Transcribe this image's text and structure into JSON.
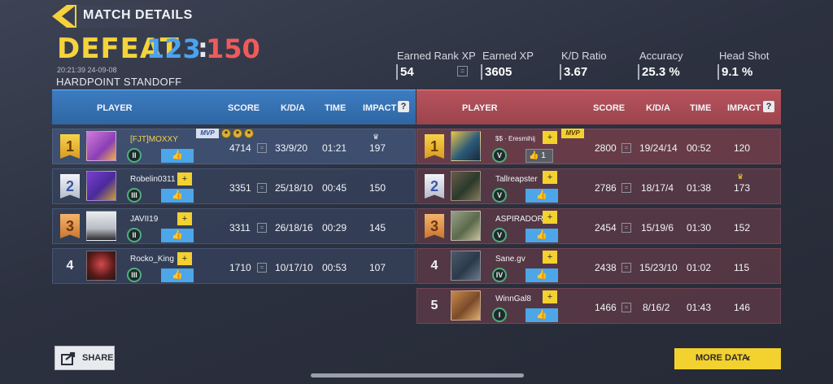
{
  "header": {
    "title": "MATCH DETAILS",
    "result": "DEFEAT",
    "score_blue": "123",
    "score_sep": ":",
    "score_red": "150",
    "time": "20:21:39 24-09-08",
    "mode": "HARDPOINT  STANDOFF"
  },
  "stats": [
    {
      "label": "Earned Rank XP",
      "value": "54"
    },
    {
      "label": "Earned XP",
      "value": "3605"
    },
    {
      "label": "K/D Ratio",
      "value": "3.67"
    },
    {
      "label": "Accuracy",
      "value": "25.3 %"
    },
    {
      "label": "Head Shot",
      "value": "9.1 %"
    }
  ],
  "columns": {
    "player": "PLAYER",
    "score": "SCORE",
    "kda": "K/D/A",
    "time": "TIME",
    "impact": "IMPACT",
    "help": "?"
  },
  "blue_team": [
    {
      "rank": "1",
      "name": "[FJT]MOXXY",
      "level": "II",
      "score": "4714",
      "kda": "33/9/20",
      "time": "01:21",
      "impact": "197",
      "mvp": "MVP"
    },
    {
      "rank": "2",
      "name": "Robelin0311",
      "level": "III",
      "score": "3351",
      "kda": "25/18/10",
      "time": "00:45",
      "impact": "150"
    },
    {
      "rank": "3",
      "name": "JAVII19",
      "level": "II",
      "score": "3311",
      "kda": "26/18/16",
      "time": "00:29",
      "impact": "145"
    },
    {
      "rank": "4",
      "name": "Rocko_King",
      "level": "III",
      "score": "1710",
      "kda": "10/17/10",
      "time": "00:53",
      "impact": "107"
    }
  ],
  "red_team": [
    {
      "rank": "1",
      "name": "$$ · Eresmihij",
      "level": "V",
      "score": "2800",
      "kda": "19/24/14",
      "time": "00:52",
      "impact": "120",
      "mvp": "MVP",
      "likes": "1"
    },
    {
      "rank": "2",
      "name": "Tallreapster",
      "level": "V",
      "score": "2786",
      "kda": "18/17/4",
      "time": "01:38",
      "impact": "173"
    },
    {
      "rank": "3",
      "name": "ASPIRADORA",
      "level": "V",
      "score": "2454",
      "kda": "15/19/6",
      "time": "01:30",
      "impact": "152"
    },
    {
      "rank": "4",
      "name": "Sane.gv",
      "level": "IV",
      "score": "2438",
      "kda": "15/23/10",
      "time": "01:02",
      "impact": "115"
    },
    {
      "rank": "5",
      "name": "WinnGal8",
      "level": "I",
      "score": "1466",
      "kda": "8/16/2",
      "time": "01:43",
      "impact": "146"
    }
  ],
  "buttons": {
    "share": "SHARE",
    "more": "MORE DATA"
  },
  "colors": {
    "accent": "#f3d12f",
    "blue_team": "#3c7cc1",
    "red_team": "#b7535c",
    "score_blue": "#4aa3f0",
    "score_red": "#f05a5a"
  }
}
